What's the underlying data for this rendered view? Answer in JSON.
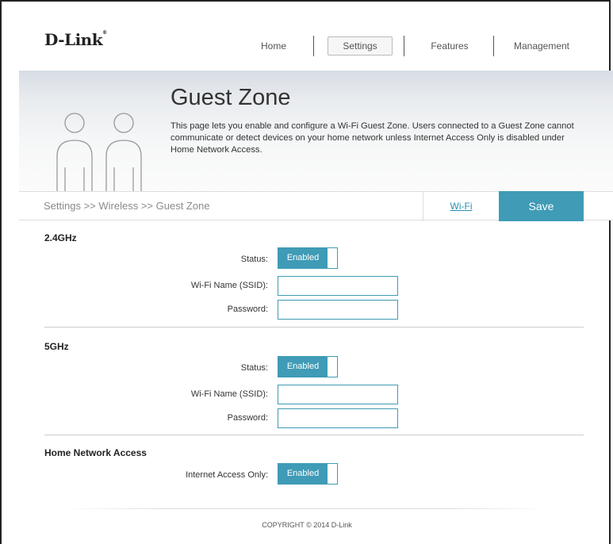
{
  "brand": {
    "logo_text": "D-Link",
    "logo_mark": "®"
  },
  "nav": {
    "home": "Home",
    "settings": "Settings",
    "features": "Features",
    "management": "Management"
  },
  "banner": {
    "icon": "users-icon",
    "title": "Guest Zone",
    "description": "This page lets you enable and configure a Wi-Fi Guest Zone. Users connected to a Guest Zone cannot communicate or detect devices on your home network unless Internet Access Only is disabled under Home Network Access."
  },
  "breadcrumb": "Settings >> Wireless >> Guest Zone",
  "actions": {
    "wifi_link": "Wi-Fi",
    "save": "Save"
  },
  "band24": {
    "title": "2.4GHz",
    "status_label": "Status:",
    "status_value": "Enabled",
    "ssid_label": "Wi-Fi Name (SSID):",
    "ssid_value": "",
    "password_label": "Password:",
    "password_value": ""
  },
  "band5": {
    "title": "5GHz",
    "status_label": "Status:",
    "status_value": "Enabled",
    "ssid_label": "Wi-Fi Name (SSID):",
    "ssid_value": "",
    "password_label": "Password:",
    "password_value": ""
  },
  "home_network": {
    "title": "Home Network Access",
    "internet_only_label": "Internet Access Only:",
    "internet_only_value": "Enabled"
  },
  "footer": {
    "copyright": "COPYRIGHT © 2014 D-Link"
  },
  "colors": {
    "accent": "#3f9bb6",
    "link": "#2b8fae"
  }
}
